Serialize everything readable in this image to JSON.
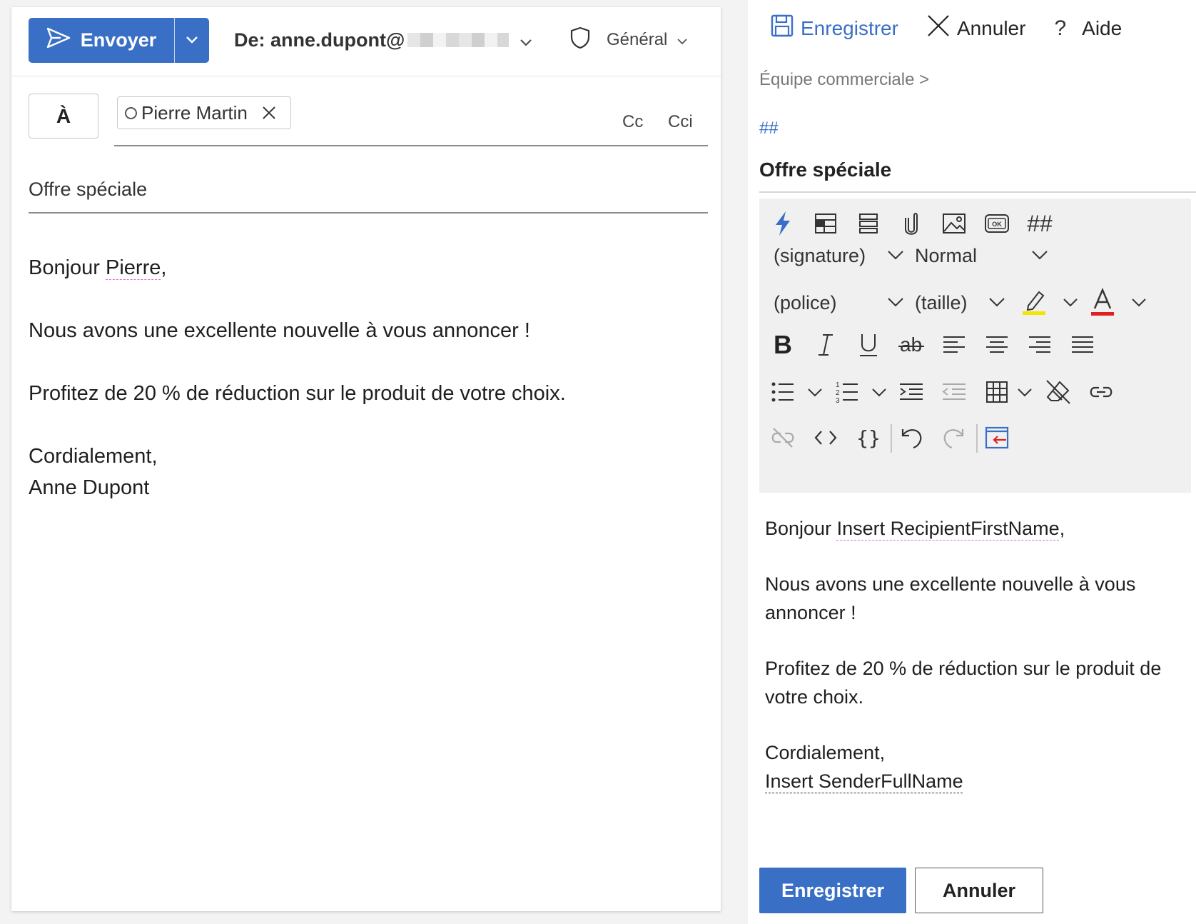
{
  "compose": {
    "send_label": "Envoyer",
    "from_label": "De: anne.dupont@",
    "sensitivity_label": "Général",
    "to_label": "À",
    "recipient_name": "Pierre Martin",
    "cc_label": "Cc",
    "bcc_label": "Cci",
    "subject": "Offre spéciale",
    "body": {
      "greeting_prefix": "Bonjour ",
      "greeting_name": "Pierre",
      "greeting_suffix": ",",
      "line1": "Nous avons une excellente nouvelle à vous annoncer !",
      "line2": "Profitez de 20 % de réduction sur le produit de votre choix.",
      "closing": "Cordialement,",
      "signature": "Anne Dupont"
    }
  },
  "panel": {
    "save_label": "Enregistrer",
    "cancel_label": "Annuler",
    "help_label": "Aide",
    "breadcrumb": "Équipe commerciale >",
    "hash_link": "##",
    "template_title": "Offre spéciale",
    "toolbar": {
      "hash_label": "##",
      "signature_dropdown": "(signature)",
      "style_dropdown": "Normal",
      "font_dropdown": "(police)",
      "size_dropdown": "(taille)"
    },
    "body": {
      "greeting_prefix": "Bonjour ",
      "greeting_placeholder": "Insert RecipientFirstName",
      "greeting_suffix": ",",
      "line1": "Nous avons une excellente nouvelle à vous annoncer !",
      "line2": "Profitez de 20 % de réduction sur le produit de votre choix.",
      "closing": "Cordialement,",
      "signature_placeholder": "Insert SenderFullName"
    },
    "footer": {
      "save_label": "Enregistrer",
      "cancel_label": "Annuler"
    }
  },
  "colors": {
    "accent": "#3a6fc6",
    "highlight": "#f2e600",
    "font_color": "#e02020"
  }
}
